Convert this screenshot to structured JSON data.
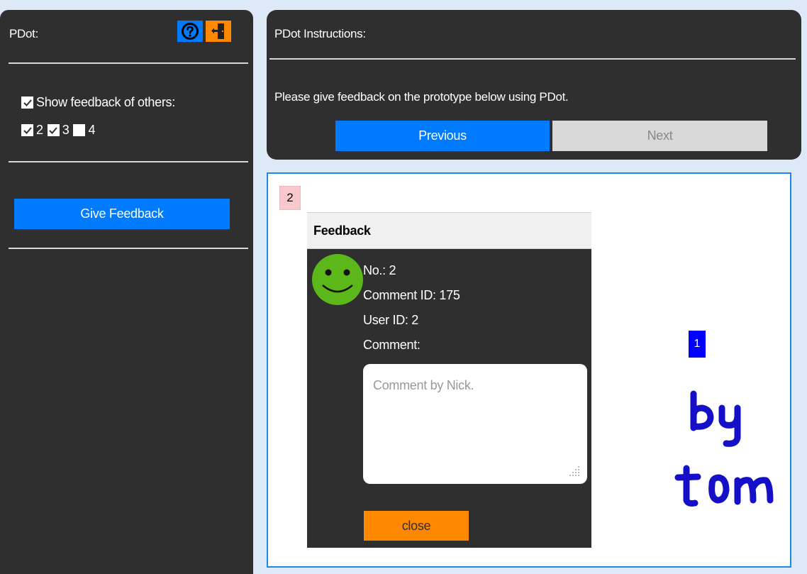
{
  "sidebar": {
    "title": "PDot:",
    "show_feedback_label": "Show feedback of others:",
    "filters": [
      {
        "label": "2",
        "checked": true
      },
      {
        "label": "3",
        "checked": true
      },
      {
        "label": "4",
        "checked": false
      }
    ],
    "give_feedback_label": "Give Feedback",
    "help_icon": "help-icon",
    "exit_icon": "exit-door-icon",
    "colors": {
      "accent": "#007bff",
      "exit": "#ff8800",
      "panel": "#2f2f2f"
    }
  },
  "instructions": {
    "title": "PDot Instructions:",
    "text": "Please give feedback on the prototype below using PDot.",
    "previous_label": "Previous",
    "next_label": "Next"
  },
  "prototype": {
    "marker_label": "2",
    "feedback": {
      "header": "Feedback",
      "no": "No.: 2",
      "comment_id": "Comment ID: 175",
      "user_id": "User ID: 2",
      "comment_label": "Comment:",
      "comment_text": "Comment by Nick.",
      "close_label": "close",
      "avatar_icon": "smiley-icon"
    },
    "other_marker_label": "1",
    "handwriting": "by tom"
  }
}
